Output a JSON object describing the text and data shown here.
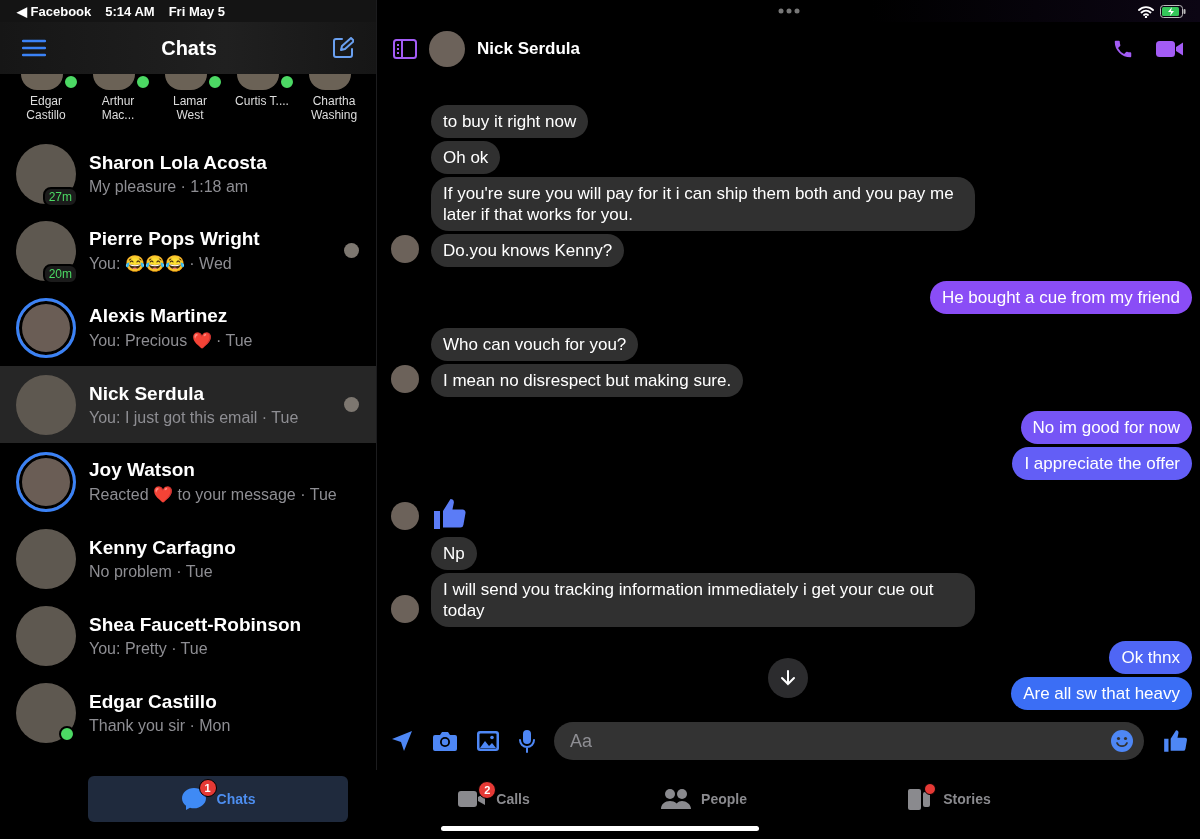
{
  "status_bar": {
    "back_app": "◀ Facebook",
    "time": "5:14 AM",
    "date": "Fri May 5"
  },
  "sidebar": {
    "title": "Chats",
    "active_now": [
      {
        "name": "Edgar Castillo",
        "online": true
      },
      {
        "name": "Arthur Mac...",
        "online": true
      },
      {
        "name": "Lamar West",
        "online": true
      },
      {
        "name": "Curtis T....",
        "online": true
      },
      {
        "name": "Chartha Washing",
        "online": false
      }
    ],
    "chats": [
      {
        "name": "Sharon Lola Acosta",
        "preview": "My pleasure · 1:18 am",
        "active_badge": "27m",
        "story_ring": false,
        "online": false,
        "seen": false,
        "selected": false
      },
      {
        "name": "Pierre Pops Wright",
        "preview": "You: 😂😂😂 · Wed",
        "active_badge": "20m",
        "story_ring": false,
        "online": false,
        "seen": true,
        "selected": false
      },
      {
        "name": "Alexis Martinez",
        "preview": "You: Precious ❤️ · Tue",
        "story_ring": true,
        "online": false,
        "seen": false,
        "selected": false
      },
      {
        "name": "Nick Serdula",
        "preview": "You: I just got this email · Tue",
        "story_ring": false,
        "online": false,
        "seen": true,
        "selected": true
      },
      {
        "name": "Joy Watson",
        "preview": "Reacted ❤️ to your message  · Tue",
        "story_ring": true,
        "online": false,
        "seen": false,
        "selected": false
      },
      {
        "name": "Kenny Carfagno",
        "preview": "No problem · Tue",
        "story_ring": false,
        "online": false,
        "seen": false,
        "selected": false
      },
      {
        "name": "Shea Faucett-Robinson",
        "preview": "You: Pretty · Tue",
        "story_ring": false,
        "online": false,
        "seen": false,
        "selected": false
      },
      {
        "name": "Edgar Castillo",
        "preview": "Thank you sir · Mon",
        "story_ring": false,
        "online": true,
        "seen": false,
        "selected": false
      }
    ]
  },
  "conversation": {
    "contact_name": "Nick Serdula",
    "messages": [
      {
        "outgoing": false,
        "kind": "text",
        "text": "to buy it right now",
        "avatar": false
      },
      {
        "outgoing": false,
        "kind": "text",
        "text": "Oh ok",
        "avatar": false
      },
      {
        "outgoing": false,
        "kind": "text",
        "text": "If you're sure you will pay for it i can ship them both and you pay me later if that works for you.",
        "avatar": false
      },
      {
        "outgoing": false,
        "kind": "text",
        "text": "Do.you knows Kenny?",
        "avatar": true
      },
      {
        "outgoing": true,
        "kind": "text",
        "text": "He bought a cue from my friend"
      },
      {
        "outgoing": false,
        "kind": "text",
        "text": "Who can vouch for you?",
        "avatar": false
      },
      {
        "outgoing": false,
        "kind": "text",
        "text": "I mean no disrespect but making sure.",
        "avatar": true
      },
      {
        "outgoing": true,
        "kind": "text",
        "text": "No im good for now"
      },
      {
        "outgoing": true,
        "kind": "text",
        "text": "I appreciate  the offer"
      },
      {
        "outgoing": false,
        "kind": "like",
        "avatar": true
      },
      {
        "outgoing": false,
        "kind": "text",
        "text": "Np",
        "avatar": false
      },
      {
        "outgoing": false,
        "kind": "text",
        "text": "I will send you tracking information immediately i get your cue out today",
        "avatar": true
      },
      {
        "outgoing": true,
        "kind": "text",
        "text": "Ok thnx"
      },
      {
        "outgoing": true,
        "kind": "text",
        "text": "Are all sw that heavy"
      }
    ],
    "composer": {
      "placeholder": "Aa"
    }
  },
  "tab_bar": [
    {
      "label": "Chats",
      "badge": "1",
      "new_dot": false,
      "selected": true
    },
    {
      "label": "Calls",
      "badge": "2",
      "new_dot": false,
      "selected": false
    },
    {
      "label": "People",
      "new_dot": false,
      "selected": false
    },
    {
      "label": "Stories",
      "new_dot": true,
      "selected": false
    }
  ]
}
